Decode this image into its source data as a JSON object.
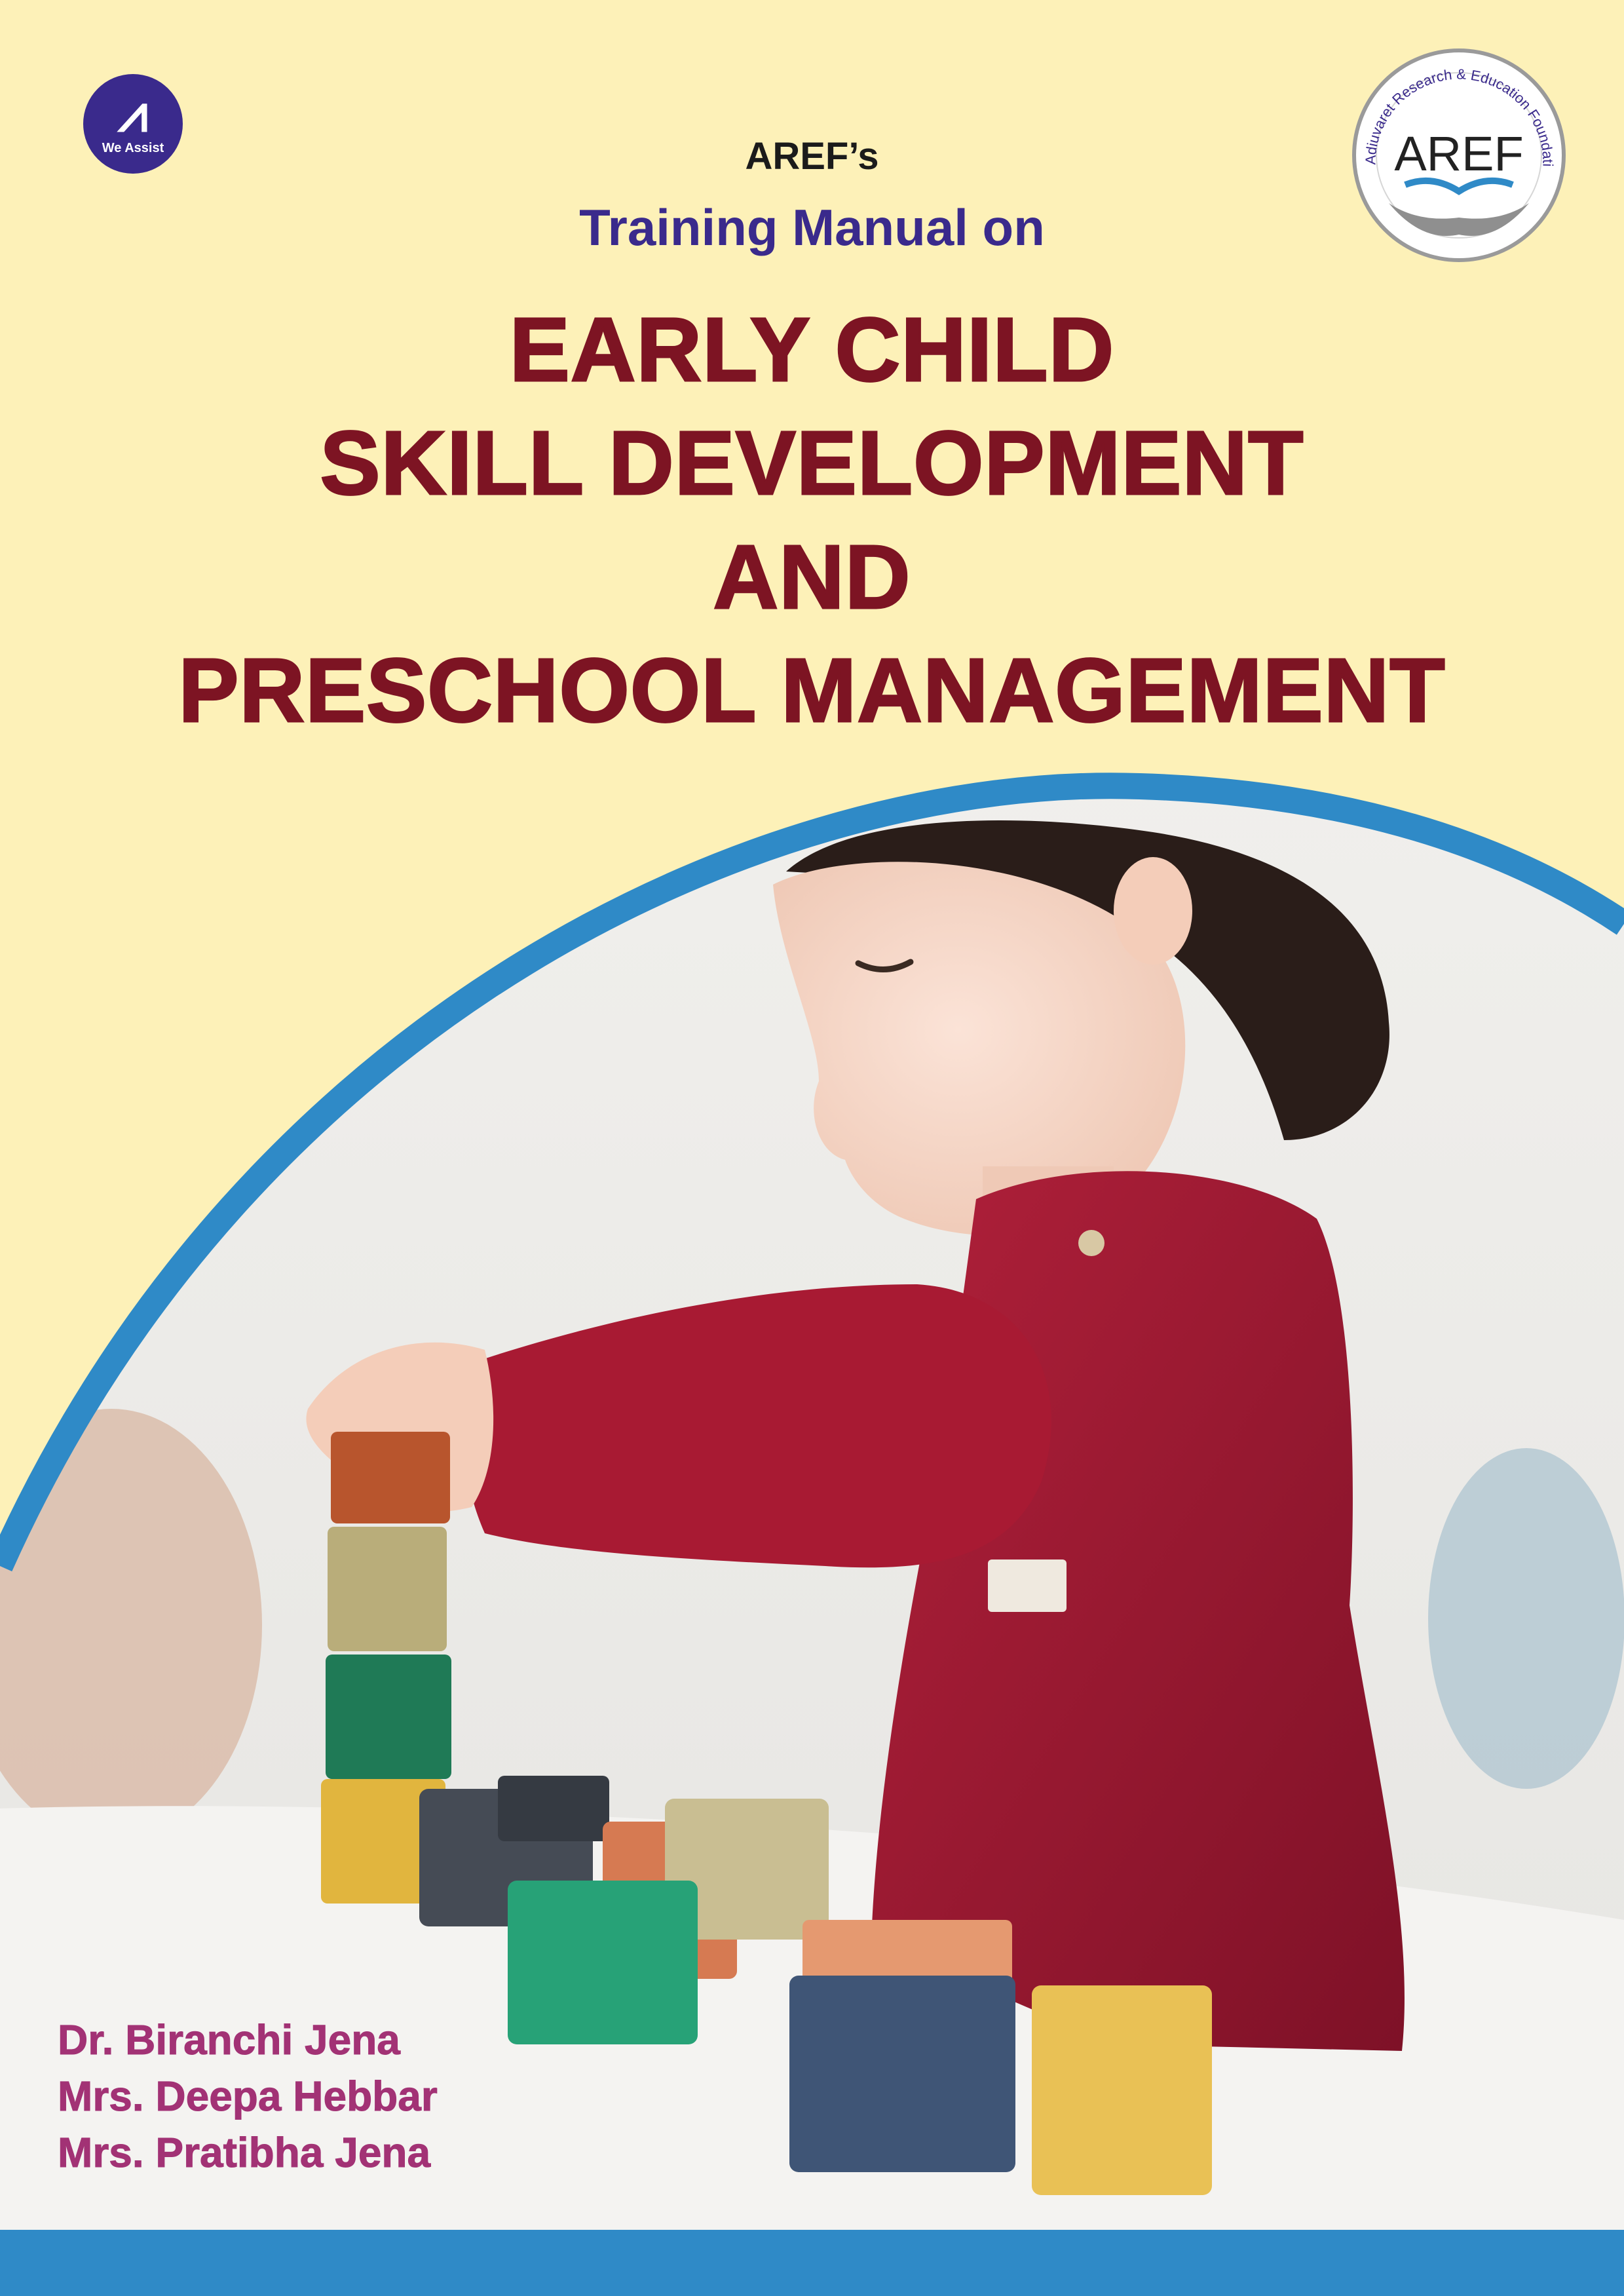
{
  "header": {
    "publisher_badge": {
      "text": "We Assist",
      "icon": "climber-icon"
    },
    "foundation_logo": {
      "ring_text": "Adiuvaret Research & Education Foundation",
      "wordmark": "AREF",
      "icon": "open-book-hands-icon"
    },
    "kicker": "AREF’s",
    "subtitle": "Training Manual on"
  },
  "title": {
    "line1": "EARLY CHILD",
    "line2": "SKILL DEVELOPMENT",
    "line3": "AND",
    "line4": "PRESCHOOL MANAGEMENT"
  },
  "authors": [
    "Dr. Biranchi Jena",
    "Mrs. Deepa Hebbar",
    "Mrs. Pratibha Jena"
  ],
  "colors": {
    "background": "#fdf1b8",
    "title": "#7d1423",
    "subtitle": "#3a2a8c",
    "authors": "#a23275",
    "accent_blue": "#2f8ac7"
  }
}
